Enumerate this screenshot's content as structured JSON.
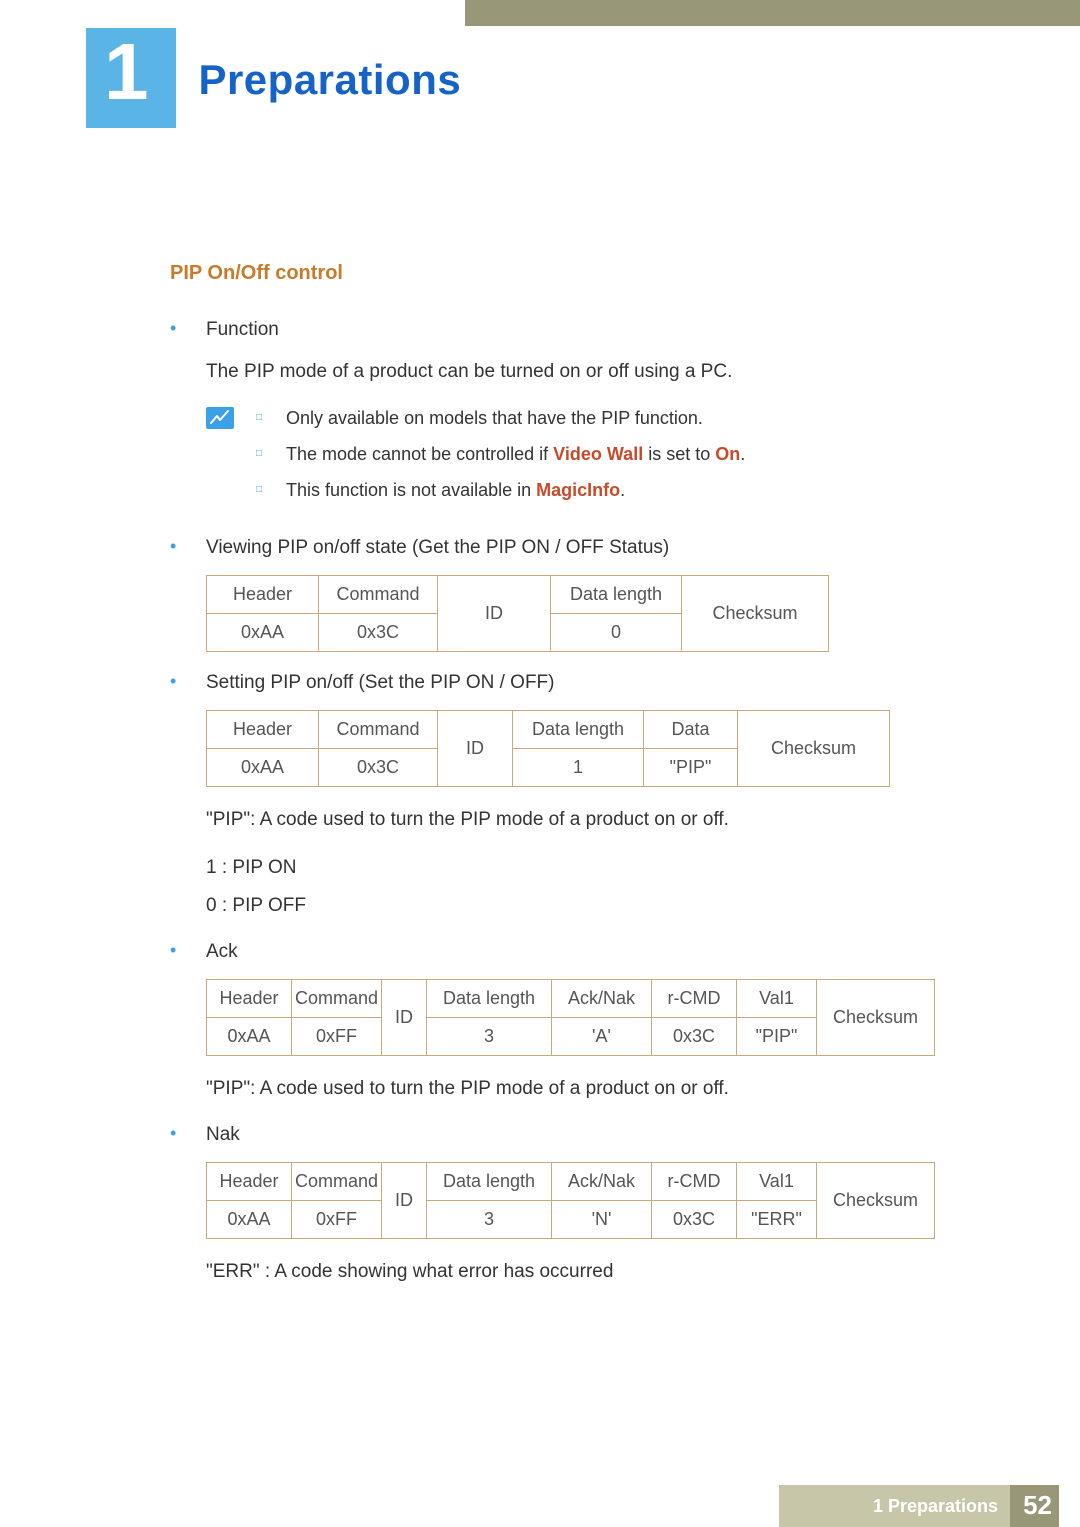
{
  "chapter": {
    "number": "1",
    "title": "Preparations"
  },
  "section": {
    "heading": "PIP On/Off control"
  },
  "func": {
    "label": "Function",
    "desc": "The PIP mode of a product can be turned on or off using a PC."
  },
  "notes": {
    "n1": "Only available on models that have the PIP function.",
    "n2a": "The mode cannot be controlled if ",
    "n2b": "Video Wall",
    "n2c": " is set to ",
    "n2d": "On",
    "n2e": ".",
    "n3a": "This function is not available in ",
    "n3b": "MagicInfo",
    "n3c": "."
  },
  "view": {
    "label": "Viewing PIP on/off state (Get the PIP ON / OFF Status)",
    "h": {
      "header": "Header",
      "cmd": "Command",
      "id": "ID",
      "dlen": "Data length",
      "chk": "Checksum"
    },
    "v": {
      "header": "0xAA",
      "cmd": "0x3C",
      "dlen": "0"
    }
  },
  "set": {
    "label": "Setting PIP on/off (Set the PIP ON / OFF)",
    "h": {
      "header": "Header",
      "cmd": "Command",
      "id": "ID",
      "dlen": "Data length",
      "data": "Data",
      "chk": "Checksum"
    },
    "v": {
      "header": "0xAA",
      "cmd": "0x3C",
      "dlen": "1",
      "data": "\"PIP\""
    }
  },
  "pip_desc": "\"PIP\": A code used to turn the PIP mode of a product on or off.",
  "pip_on": "1 : PIP ON",
  "pip_off": "0 : PIP OFF",
  "ack": {
    "label": "Ack",
    "h": {
      "header": "Header",
      "cmd": "Command",
      "id": "ID",
      "dlen": "Data length",
      "ack": "Ack/Nak",
      "rcmd": "r-CMD",
      "val1": "Val1",
      "chk": "Checksum"
    },
    "v": {
      "header": "0xAA",
      "cmd": "0xFF",
      "dlen": "3",
      "ack": "'A'",
      "rcmd": "0x3C",
      "val1": "\"PIP\""
    },
    "desc": "\"PIP\": A code used to turn the PIP mode of a product on or off."
  },
  "nak": {
    "label": "Nak",
    "h": {
      "header": "Header",
      "cmd": "Command",
      "id": "ID",
      "dlen": "Data length",
      "ack": "Ack/Nak",
      "rcmd": "r-CMD",
      "val1": "Val1",
      "chk": "Checksum"
    },
    "v": {
      "header": "0xAA",
      "cmd": "0xFF",
      "dlen": "3",
      "ack": "'N'",
      "rcmd": "0x3C",
      "val1": "\"ERR\""
    },
    "desc": "\"ERR\" : A code showing what error has occurred"
  },
  "footer": {
    "label": "1 Preparations",
    "page": "52"
  }
}
